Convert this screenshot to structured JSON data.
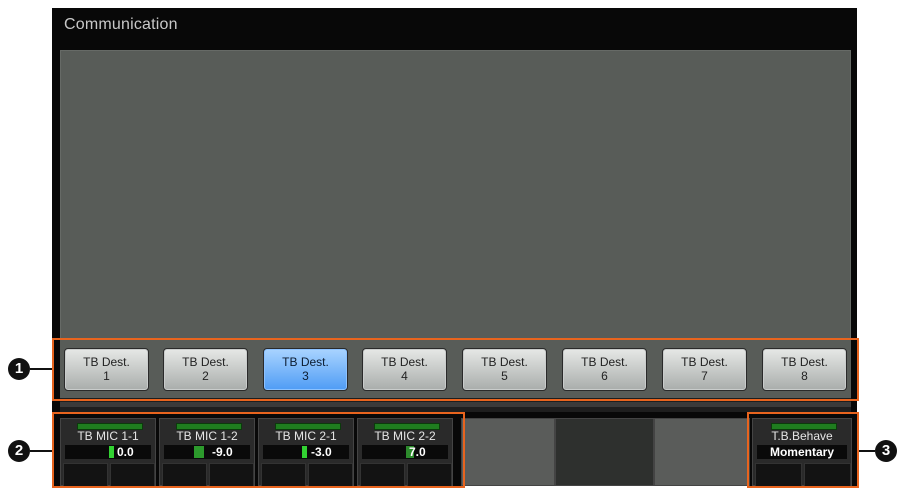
{
  "window": {
    "title": "Communication"
  },
  "destinations": [
    {
      "line1": "TB Dest.",
      "line2": "1",
      "active": false
    },
    {
      "line1": "TB Dest.",
      "line2": "2",
      "active": false
    },
    {
      "line1": "TB Dest.",
      "line2": "3",
      "active": true
    },
    {
      "line1": "TB Dest.",
      "line2": "4",
      "active": false
    },
    {
      "line1": "TB Dest.",
      "line2": "5",
      "active": false
    },
    {
      "line1": "TB Dest.",
      "line2": "6",
      "active": false
    },
    {
      "line1": "TB Dest.",
      "line2": "7",
      "active": false
    },
    {
      "line1": "TB Dest.",
      "line2": "8",
      "active": false
    }
  ],
  "mics": [
    {
      "name": "TB MIC 1-1",
      "value": "0.0"
    },
    {
      "name": "TB MIC 1-2",
      "value": "-9.0"
    },
    {
      "name": "TB MIC 2-1",
      "value": "-3.0"
    },
    {
      "name": "TB MIC 2-2",
      "value": "7.0"
    }
  ],
  "behave": {
    "name": "T.B.Behave",
    "value": "Momentary"
  },
  "callouts": [
    "1",
    "2",
    "3"
  ],
  "colors": {
    "active_button": "#4f9cf5",
    "callout_border": "#e8641e",
    "level_green": "#32d232"
  }
}
